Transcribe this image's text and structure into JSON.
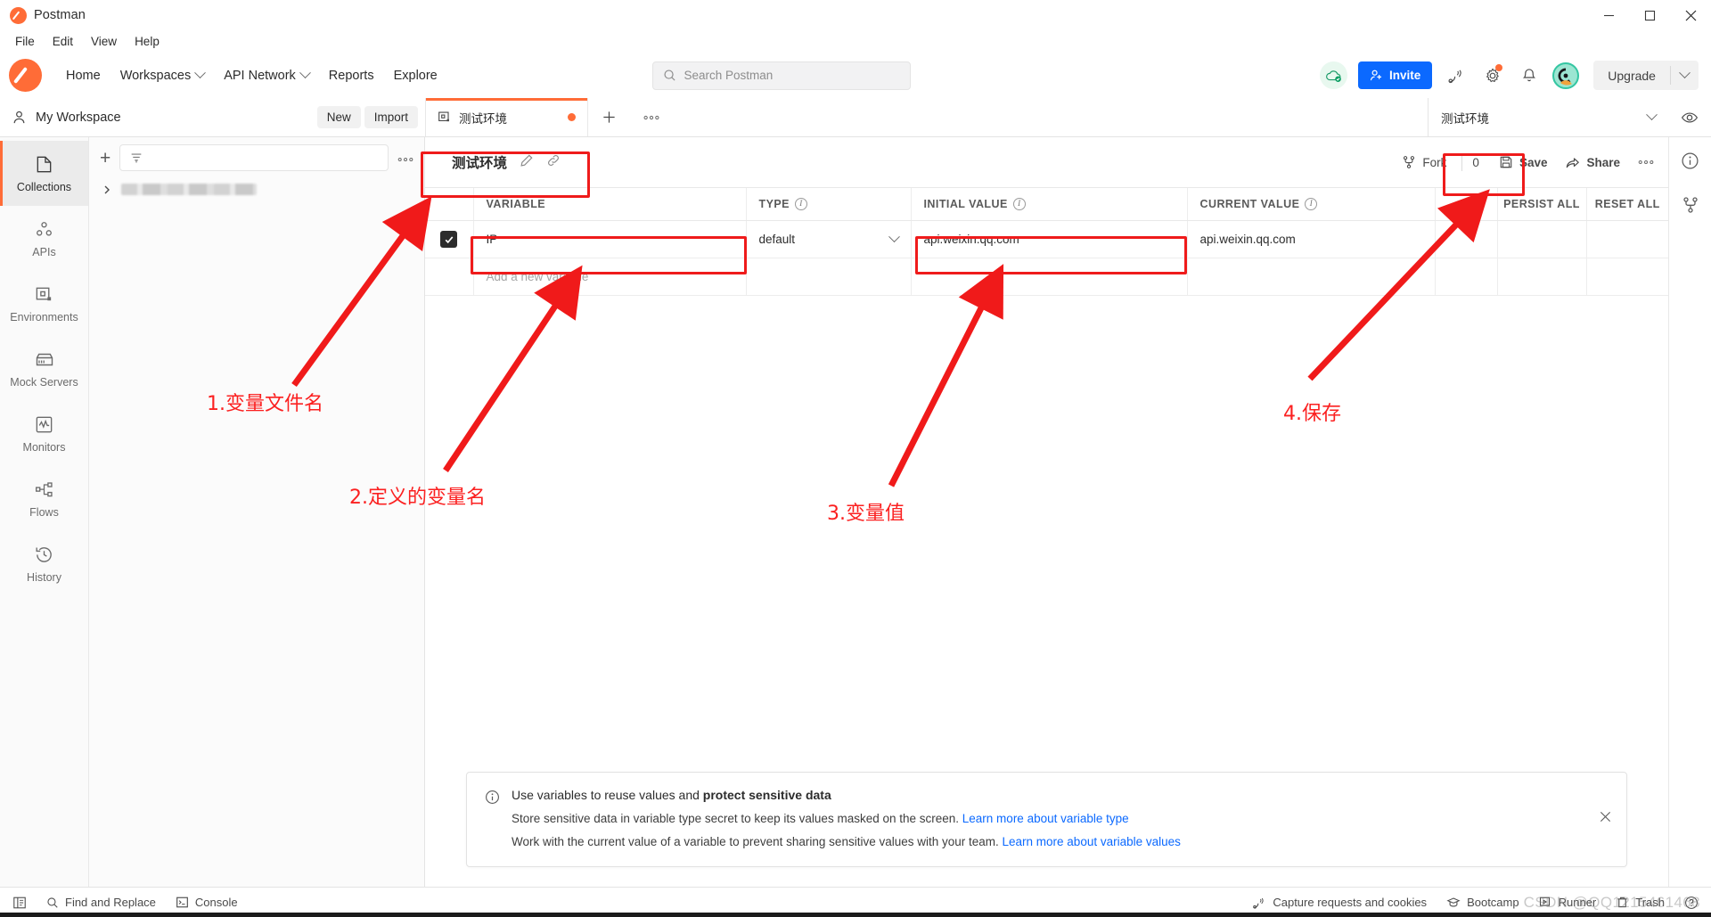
{
  "window": {
    "title": "Postman",
    "controls": [
      "minimize",
      "maximize",
      "close"
    ]
  },
  "menubar": {
    "items": [
      {
        "label": "File"
      },
      {
        "label": "Edit"
      },
      {
        "label": "View"
      },
      {
        "label": "Help"
      }
    ]
  },
  "topnav": {
    "links": [
      {
        "label": "Home",
        "caret": false
      },
      {
        "label": "Workspaces",
        "caret": true
      },
      {
        "label": "API Network",
        "caret": true
      },
      {
        "label": "Reports",
        "caret": false
      },
      {
        "label": "Explore",
        "caret": false
      }
    ],
    "search": {
      "placeholder": "Search Postman",
      "value": ""
    },
    "invite_label": "Invite",
    "upgrade_label": "Upgrade",
    "icons": [
      "cloud-sync-icon",
      "satellite-icon",
      "gear-icon",
      "bell-icon",
      "avatar"
    ]
  },
  "workspace": {
    "name": "My Workspace",
    "new_label": "New",
    "import_label": "Import"
  },
  "tabs": [
    {
      "label": "测试环境",
      "icon": "environment-icon",
      "dirty": true,
      "active": true
    }
  ],
  "env_selector": {
    "value": "测试环境"
  },
  "rail": {
    "items": [
      {
        "label": "Collections",
        "icon": "collections-icon",
        "active": true
      },
      {
        "label": "APIs",
        "icon": "apis-icon",
        "active": false
      },
      {
        "label": "Environments",
        "icon": "environments-icon",
        "active": false
      },
      {
        "label": "Mock Servers",
        "icon": "mock-servers-icon",
        "active": false
      },
      {
        "label": "Monitors",
        "icon": "monitors-icon",
        "active": false
      },
      {
        "label": "Flows",
        "icon": "flows-icon",
        "active": false
      },
      {
        "label": "History",
        "icon": "history-icon",
        "active": false
      }
    ]
  },
  "sidepanel": {
    "filter_placeholder": "",
    "item_redacted": true
  },
  "env_header": {
    "title": "测试环境",
    "fork_label": "Fork",
    "fork_count": "0",
    "save_label": "Save",
    "share_label": "Share"
  },
  "variables_table": {
    "columns": [
      {
        "key": "variable",
        "label": "VARIABLE",
        "info": false
      },
      {
        "key": "type",
        "label": "TYPE",
        "info": true
      },
      {
        "key": "initial",
        "label": "INITIAL VALUE",
        "info": true
      },
      {
        "key": "current",
        "label": "CURRENT VALUE",
        "info": true
      }
    ],
    "header_actions": {
      "more": "•••",
      "persist_all": "Persist All",
      "reset_all": "Reset All"
    },
    "rows": [
      {
        "enabled": true,
        "variable": "IP",
        "type": "default",
        "initial": "api.weixin.qq.com",
        "current": "api.weixin.qq.com"
      }
    ],
    "new_row_placeholder": "Add a new variable"
  },
  "banner": {
    "title_plain": "Use variables to reuse values and ",
    "title_bold": "protect sensitive data",
    "line1_text": "Store sensitive data in variable type secret to keep its values masked on the screen. ",
    "line1_link": "Learn more about variable type",
    "line2_text": "Work with the current value of a variable to prevent sharing sensitive values with your team. ",
    "line2_link": "Learn more about variable values",
    "close_label": "×"
  },
  "statusbar": {
    "left": [
      {
        "label": "",
        "icon": "sidebar-toggle-icon"
      },
      {
        "label": "Find and Replace",
        "icon": "search-icon"
      },
      {
        "label": "Console",
        "icon": "console-icon"
      }
    ],
    "right": [
      {
        "label": "Capture requests and cookies",
        "icon": "satellite-icon"
      },
      {
        "label": "Bootcamp",
        "icon": "bootcamp-icon"
      },
      {
        "label": "Runner",
        "icon": "runner-icon"
      },
      {
        "label": "Trash",
        "icon": "trash-icon"
      },
      {
        "label": "",
        "icon": "help-icon"
      }
    ],
    "watermark": "CSDN @QQ1215461468"
  },
  "annotations": [
    {
      "id": "a1",
      "text": "1.变量文件名"
    },
    {
      "id": "a2",
      "text": "2.定义的变量名"
    },
    {
      "id": "a3",
      "text": "3.变量值"
    },
    {
      "id": "a4",
      "text": "4.保存"
    }
  ],
  "colors": {
    "accent": "#ff6c37",
    "primary_button": "#0b69ff",
    "annotation_red": "#ef1b1b",
    "link": "#0b69ff"
  }
}
